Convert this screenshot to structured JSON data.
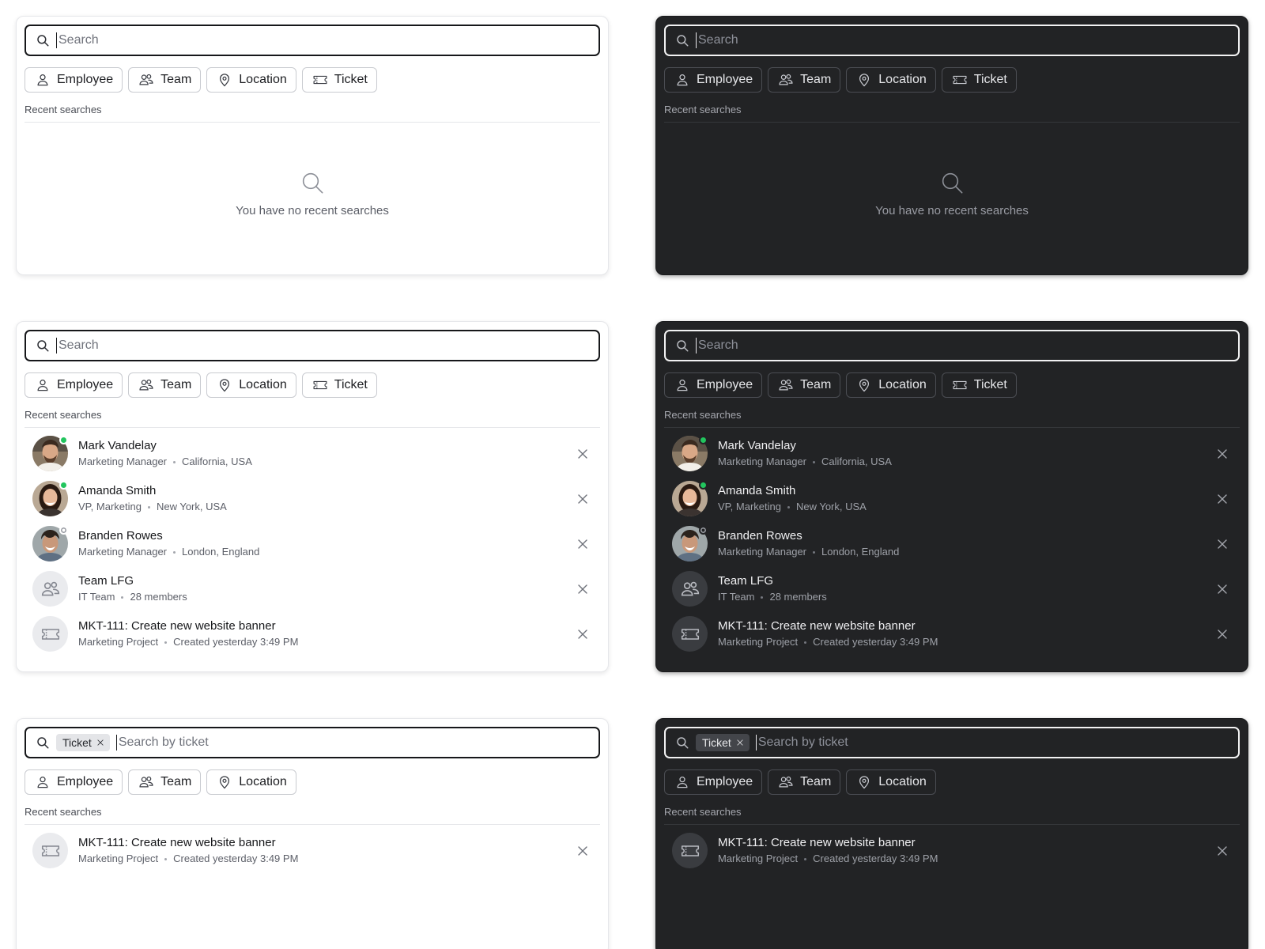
{
  "search": {
    "placeholder": "Search",
    "ticket_placeholder": "Search by ticket",
    "active_filter": "Ticket"
  },
  "filters": {
    "employee": "Employee",
    "team": "Team",
    "location": "Location",
    "ticket": "Ticket"
  },
  "recent_label": "Recent searches",
  "empty_text": "You have no recent searches",
  "items": [
    {
      "title": "Mark Vandelay",
      "meta1": "Marketing Manager",
      "meta2": "California, USA",
      "status": "online"
    },
    {
      "title": "Amanda Smith",
      "meta1": "VP, Marketing",
      "meta2": "New York, USA",
      "status": "online"
    },
    {
      "title": "Branden Rowes",
      "meta1": "Marketing Manager",
      "meta2": "London, England",
      "status": "offline"
    },
    {
      "title": "Team LFG",
      "meta1": "IT Team",
      "meta2": "28 members"
    },
    {
      "title": "MKT-111: Create new website banner",
      "meta1": "Marketing Project",
      "meta2": "Created yesterday 3:49 PM"
    }
  ],
  "colors": {
    "online": "#22c55e",
    "dark_bg": "#222325",
    "light_bg": "#ffffff"
  },
  "icons": [
    "search-icon",
    "user-icon",
    "users-icon",
    "map-pin-icon",
    "ticket-icon",
    "close-icon"
  ]
}
